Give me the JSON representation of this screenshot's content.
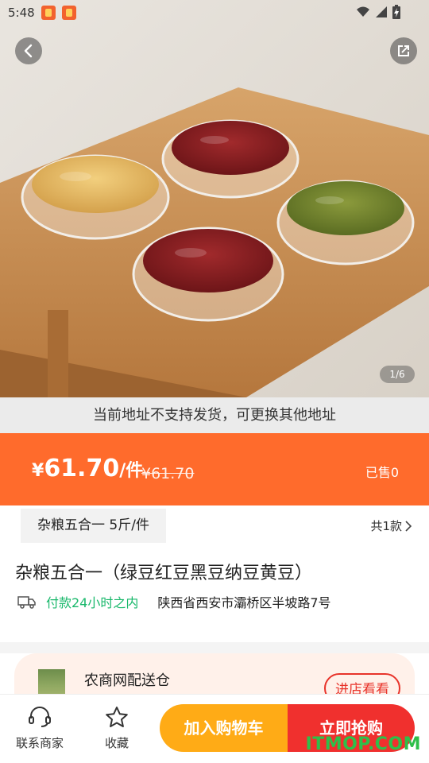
{
  "status_bar": {
    "time": "5:48"
  },
  "gallery": {
    "counter": "1/6"
  },
  "notice": "当前地址不支持发货，可更换其他地址",
  "price": {
    "currency": "¥",
    "amount": "61.70",
    "unit": "/件",
    "original": "¥61.70",
    "sold": "已售0"
  },
  "spec": {
    "selected": "杂粮五合一  5斤/件",
    "count": "共1款"
  },
  "product": {
    "title": "杂粮五合一（绿豆红豆黑豆纳豆黄豆）"
  },
  "shipping": {
    "time": "付款24小时之内",
    "address": "陕西省西安市灞桥区半坡路7号"
  },
  "store": {
    "name": "农商网配送仓",
    "enter_label": "进店看看"
  },
  "bottom": {
    "contact_label": "联系商家",
    "favorite_label": "收藏",
    "cart_label": "加入购物车",
    "buy_label": "立即抢购"
  },
  "watermark": "ITMOP.COM",
  "colors": {
    "price_bar": "#ff6b2c",
    "cart": "#ffab16",
    "buy": "#f0302e",
    "ship_time": "#19b86b"
  }
}
